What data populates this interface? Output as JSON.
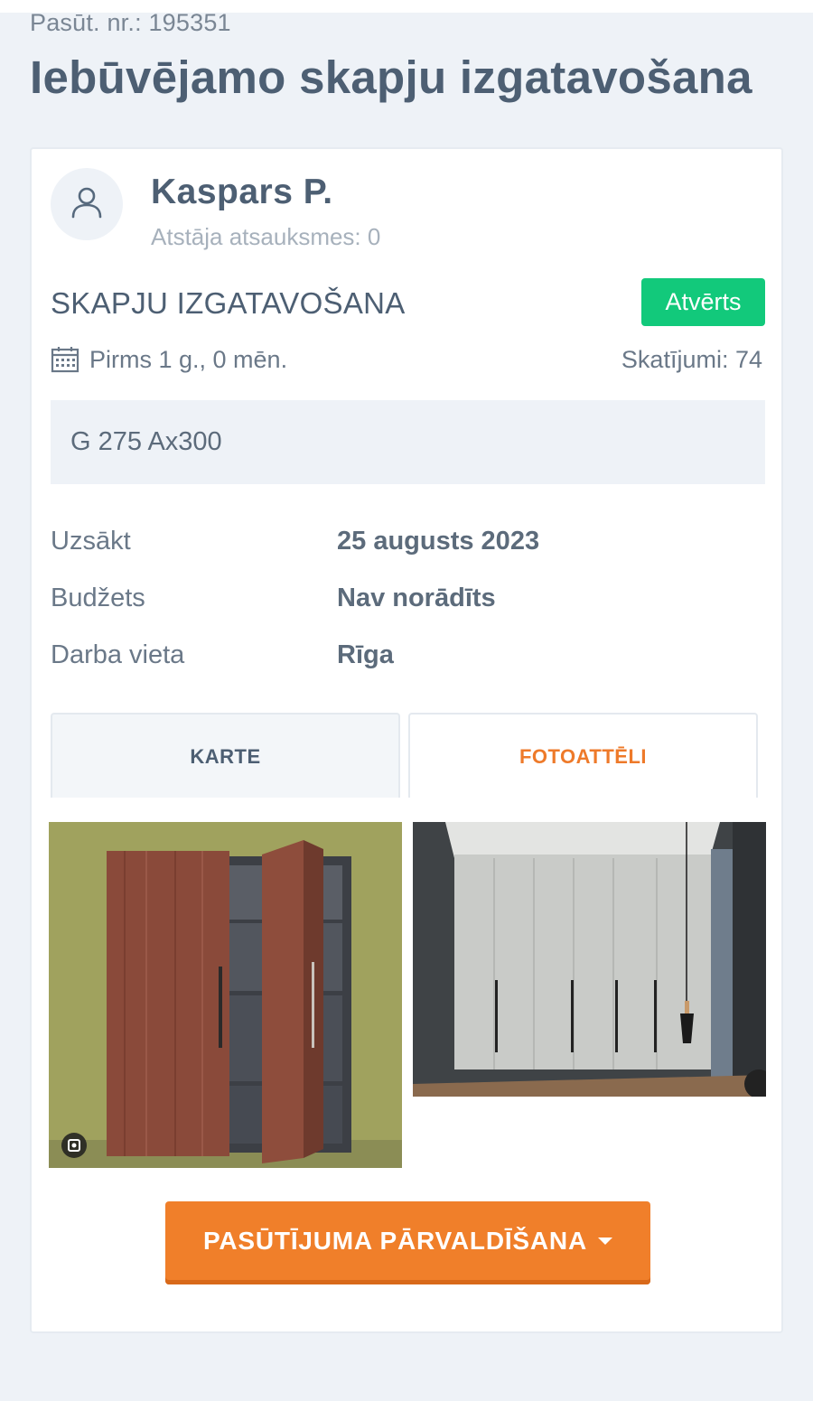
{
  "header": {
    "order_number": "Pasūt. nr.: 195351",
    "title": "Iebūvējamo skapju izgatavošana"
  },
  "client": {
    "avatar_icon": "user-icon",
    "name": "Kaspars P.",
    "reviews": "Atstāja atsauksmes: 0"
  },
  "order": {
    "category": "SKAPJU IZGATAVOŠANA",
    "status": "Atvērts",
    "status_color": "#12c97b",
    "calendar_icon": "calendar-icon",
    "posted": "Pirms 1 g., 0 mēn.",
    "views": "Skatījumi: 74",
    "description": "G 275 Ax300"
  },
  "details": [
    {
      "label": "Uzsākt",
      "value": "25 augusts 2023"
    },
    {
      "label": "Budžets",
      "value": "Nav norādīts"
    },
    {
      "label": "Darba vieta",
      "value": "Rīga"
    }
  ],
  "tabs": [
    {
      "label": "KARTE",
      "active": false
    },
    {
      "label": "FOTOATTĒLI",
      "active": true
    }
  ],
  "accent_color": "#f07f2a",
  "actions": {
    "manage_label": "PASŪTĪJUMA PĀRVALDĪŠANA",
    "manage_icon": "caret-down-icon"
  }
}
